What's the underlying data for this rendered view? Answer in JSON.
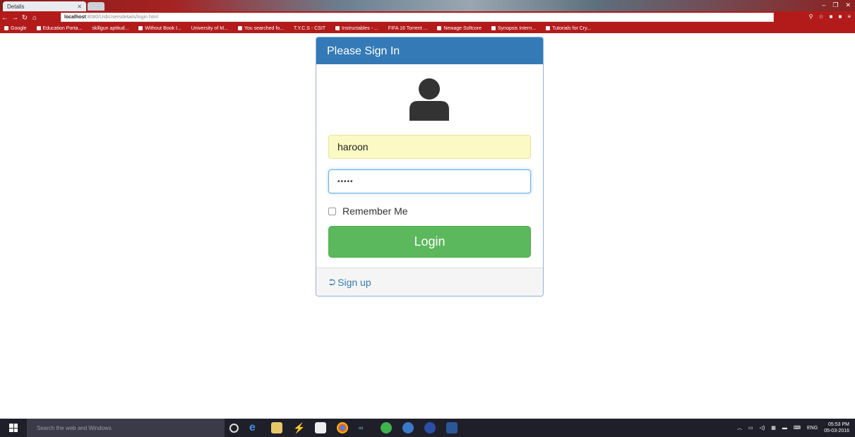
{
  "browser": {
    "tab_title": "Details",
    "url_host": "localhost",
    "url_path": ":8080/UsbUsersdetails/login.html",
    "bookmarks": [
      "Google",
      "Education Porta...",
      "skillgun aptitud...",
      "Without Book I...",
      "University of M...",
      "You searched fo...",
      "T.Y.C.S - CSIT",
      "Instructables - ...",
      "FIFA 16 Torrent ...",
      "Newage Softcore",
      "Synopsis Intern...",
      "Tutorials for Cry..."
    ]
  },
  "login": {
    "heading": "Please Sign In",
    "username_value": "haroon",
    "password_value": "•••••",
    "remember_label": "Remember Me",
    "login_label": "Login",
    "signup_label": "Sign up"
  },
  "taskbar": {
    "search_placeholder": "Search the web and Windows",
    "language": "ENG",
    "time": "05:53 PM",
    "date": "05-03-2016"
  },
  "colors": {
    "panel_primary": "#337ab7",
    "login_button": "#5cb85c",
    "autofill_bg": "#fbf9c4",
    "browser_theme": "#b31b1b"
  }
}
